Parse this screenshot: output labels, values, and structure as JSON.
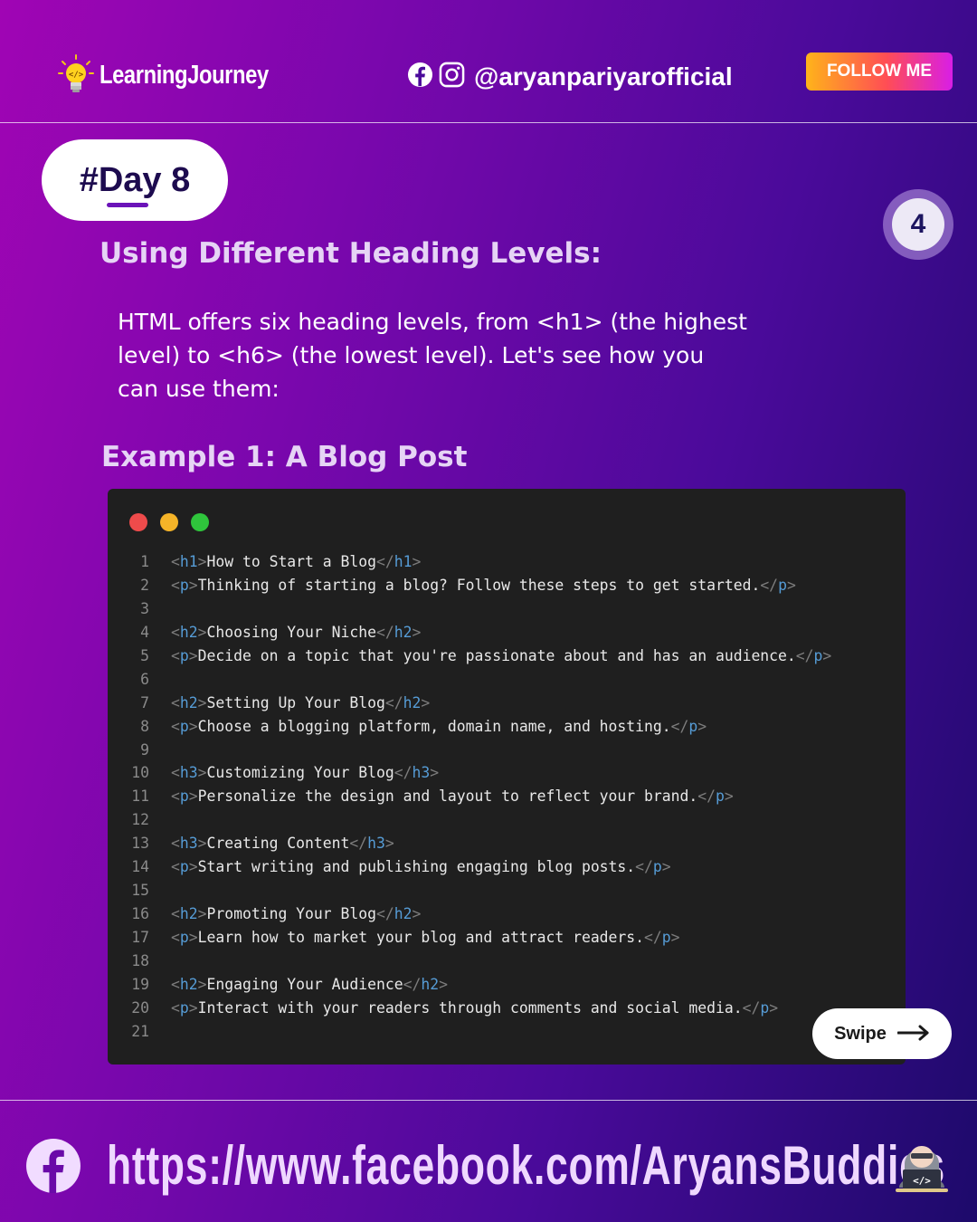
{
  "header": {
    "brand_name": "LearningJourney",
    "social_handle": "@aryanpariyarofficial",
    "follow_label": "FOLLOW ME"
  },
  "day_badge": "#Day 8",
  "page_number": "4",
  "section_title": "Using Different Heading Levels:",
  "intro_text": "HTML offers six heading levels, from <h1> (the highest level) to <h6> (the lowest level). Let's see how you can use them:",
  "example_title": "Example 1: A Blog Post",
  "code_lines": [
    {
      "num": "1",
      "tag": "h1",
      "text": "How to Start a Blog"
    },
    {
      "num": "2",
      "tag": "p",
      "text": "Thinking of starting a blog? Follow these steps to get started."
    },
    {
      "num": "3",
      "tag": "",
      "text": ""
    },
    {
      "num": "4",
      "tag": "h2",
      "text": "Choosing Your Niche"
    },
    {
      "num": "5",
      "tag": "p",
      "text": "Decide on a topic that you're passionate about and has an audience."
    },
    {
      "num": "6",
      "tag": "",
      "text": ""
    },
    {
      "num": "7",
      "tag": "h2",
      "text": "Setting Up Your Blog"
    },
    {
      "num": "8",
      "tag": "p",
      "text": "Choose a blogging platform, domain name, and hosting."
    },
    {
      "num": "9",
      "tag": "",
      "text": ""
    },
    {
      "num": "10",
      "tag": "h3",
      "text": "Customizing Your Blog"
    },
    {
      "num": "11",
      "tag": "p",
      "text": "Personalize the design and layout to reflect your brand."
    },
    {
      "num": "12",
      "tag": "",
      "text": ""
    },
    {
      "num": "13",
      "tag": "h3",
      "text": "Creating Content"
    },
    {
      "num": "14",
      "tag": "p",
      "text": "Start writing and publishing engaging blog posts."
    },
    {
      "num": "15",
      "tag": "",
      "text": ""
    },
    {
      "num": "16",
      "tag": "h2",
      "text": "Promoting Your Blog"
    },
    {
      "num": "17",
      "tag": "p",
      "text": "Learn how to market your blog and attract readers."
    },
    {
      "num": "18",
      "tag": "",
      "text": ""
    },
    {
      "num": "19",
      "tag": "h2",
      "text": "Engaging Your Audience"
    },
    {
      "num": "20",
      "tag": "p",
      "text": "Interact with your readers through comments and social media."
    },
    {
      "num": "21",
      "tag": "",
      "text": ""
    }
  ],
  "swipe_label": "Swipe",
  "footer_url": "https://www.facebook.com/AryansBuddies",
  "colors": {
    "window_red": "#ee4b4b",
    "window_yellow": "#f5b428",
    "window_green": "#2fc53c",
    "tag_color": "#569cd6",
    "follow_gradient_start": "#ffb31a",
    "follow_gradient_end": "#d81ee6"
  },
  "icons": [
    "lightbulb-icon",
    "facebook-icon",
    "instagram-icon",
    "arrow-right-icon",
    "hacker-laptop-icon"
  ]
}
